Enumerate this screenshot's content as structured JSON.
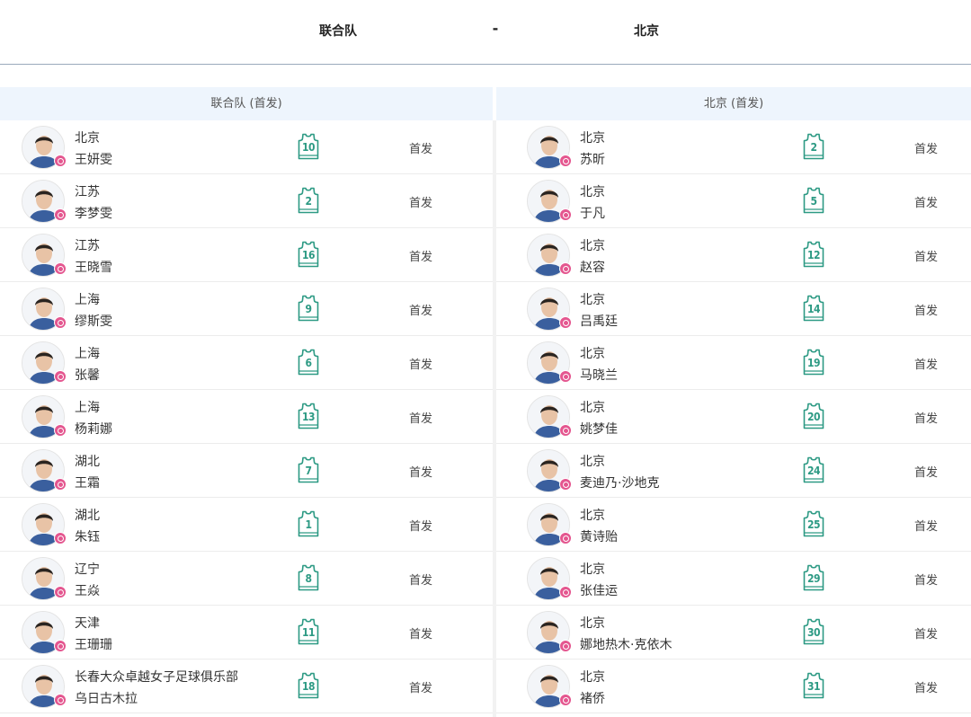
{
  "match": {
    "home": "联合队",
    "separator": "-",
    "away": "北京"
  },
  "lineups": {
    "home_header": "联合队 (首发)",
    "away_header": "北京 (首发)",
    "home_players": [
      {
        "team": "北京",
        "name": "王妍雯",
        "number": "10",
        "role": "首发",
        "avatar": "player-avatar-icon"
      },
      {
        "team": "江苏",
        "name": "李梦雯",
        "number": "2",
        "role": "首发",
        "avatar": "player-avatar-icon"
      },
      {
        "team": "江苏",
        "name": "王晓雪",
        "number": "16",
        "role": "首发",
        "avatar": "player-avatar-icon"
      },
      {
        "team": "上海",
        "name": "缪斯雯",
        "number": "9",
        "role": "首发",
        "avatar": "player-avatar-icon"
      },
      {
        "team": "上海",
        "name": "张馨",
        "number": "6",
        "role": "首发",
        "avatar": "player-avatar-icon"
      },
      {
        "team": "上海",
        "name": "杨莉娜",
        "number": "13",
        "role": "首发",
        "avatar": "player-avatar-icon"
      },
      {
        "team": "湖北",
        "name": "王霜",
        "number": "7",
        "role": "首发",
        "avatar": "player-avatar-icon"
      },
      {
        "team": "湖北",
        "name": "朱钰",
        "number": "1",
        "role": "首发",
        "avatar": "player-avatar-icon"
      },
      {
        "team": "辽宁",
        "name": "王焱",
        "number": "8",
        "role": "首发",
        "avatar": "player-avatar-icon"
      },
      {
        "team": "天津",
        "name": "王珊珊",
        "number": "11",
        "role": "首发",
        "avatar": "player-avatar-icon"
      },
      {
        "team": "长春大众卓越女子足球俱乐部",
        "name": "乌日古木拉",
        "number": "18",
        "role": "首发",
        "avatar": "player-avatar-icon"
      }
    ],
    "away_players": [
      {
        "team": "北京",
        "name": "苏昕",
        "number": "2",
        "role": "首发",
        "avatar": "player-avatar-icon"
      },
      {
        "team": "北京",
        "name": "于凡",
        "number": "5",
        "role": "首发",
        "avatar": "player-avatar-icon"
      },
      {
        "team": "北京",
        "name": "赵容",
        "number": "12",
        "role": "首发",
        "avatar": "player-avatar-icon"
      },
      {
        "team": "北京",
        "name": "吕禹廷",
        "number": "14",
        "role": "首发",
        "avatar": "player-avatar-icon"
      },
      {
        "team": "北京",
        "name": "马晓兰",
        "number": "19",
        "role": "首发",
        "avatar": "player-avatar-icon"
      },
      {
        "team": "北京",
        "name": "姚梦佳",
        "number": "20",
        "role": "首发",
        "avatar": "player-avatar-icon"
      },
      {
        "team": "北京",
        "name": "麦迪乃·沙地克",
        "number": "24",
        "role": "首发",
        "avatar": "player-avatar-icon"
      },
      {
        "team": "北京",
        "name": "黄诗贻",
        "number": "25",
        "role": "首发",
        "avatar": "player-avatar-icon"
      },
      {
        "team": "北京",
        "name": "张佳运",
        "number": "29",
        "role": "首发",
        "avatar": "player-avatar-icon"
      },
      {
        "team": "北京",
        "name": "娜地热木·克依木",
        "number": "30",
        "role": "首发",
        "avatar": "player-avatar-icon"
      },
      {
        "team": "北京",
        "name": "褚侨",
        "number": "31",
        "role": "首发",
        "avatar": "player-avatar-icon"
      }
    ]
  },
  "colors": {
    "accent": "#2d9a84",
    "badge": "#e4568f",
    "header_bg": "#eef5fd"
  }
}
